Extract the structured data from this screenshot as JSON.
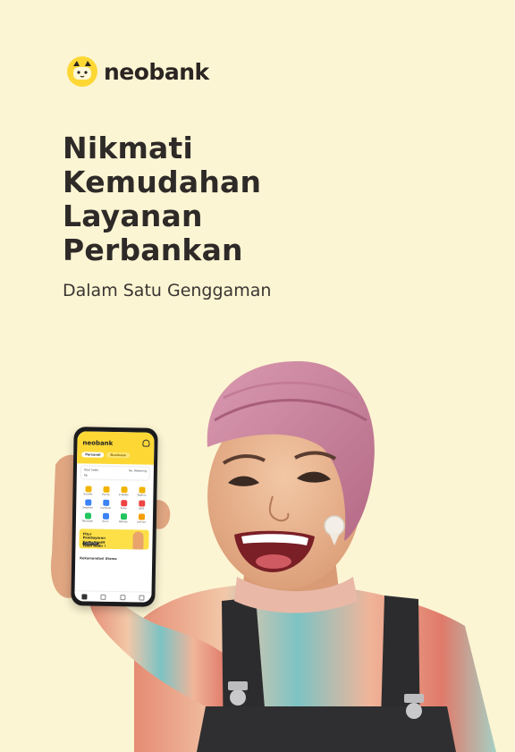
{
  "brand": {
    "name": "neobank",
    "accent": "#fdd835",
    "background": "#fcf5d3"
  },
  "headline": {
    "lines": [
      "Nikmati",
      "Kemudahan",
      "Layanan",
      "Perbankan"
    ],
    "subtitle": "Dalam Satu Genggaman"
  },
  "phone_app": {
    "logo": "neobank",
    "tabs": [
      "Personal",
      "Business"
    ],
    "balance": {
      "left_label": "Total Saldo",
      "right_label": "No. Rekening",
      "sub_label": "Rp"
    },
    "grid_items": [
      {
        "label": "Transfer",
        "color": "#f0b400"
      },
      {
        "label": "Top Up",
        "color": "#f0b400"
      },
      {
        "label": "E-Wallet",
        "color": "#f0b400"
      },
      {
        "label": "Tagihan",
        "color": "#f0b400"
      },
      {
        "label": "Deposito",
        "color": "#3b82f6"
      },
      {
        "label": "Investasi",
        "color": "#3b82f6"
      },
      {
        "label": "Pulsa",
        "color": "#ef4444"
      },
      {
        "label": "QRIS",
        "color": "#ef4444"
      },
      {
        "label": "Tabungan",
        "color": "#22c55e"
      },
      {
        "label": "Kartu",
        "color": "#3b82f6"
      },
      {
        "label": "Belanja",
        "color": "#22c55e"
      },
      {
        "label": "Lainnya",
        "color": "#f59e0b"
      }
    ],
    "promo": {
      "title": "Fitur Pembayaran Kartu Kredit Telah Hadir !",
      "button": "Cobain Yuk"
    },
    "section_title": "Rekomendasi Utama"
  }
}
